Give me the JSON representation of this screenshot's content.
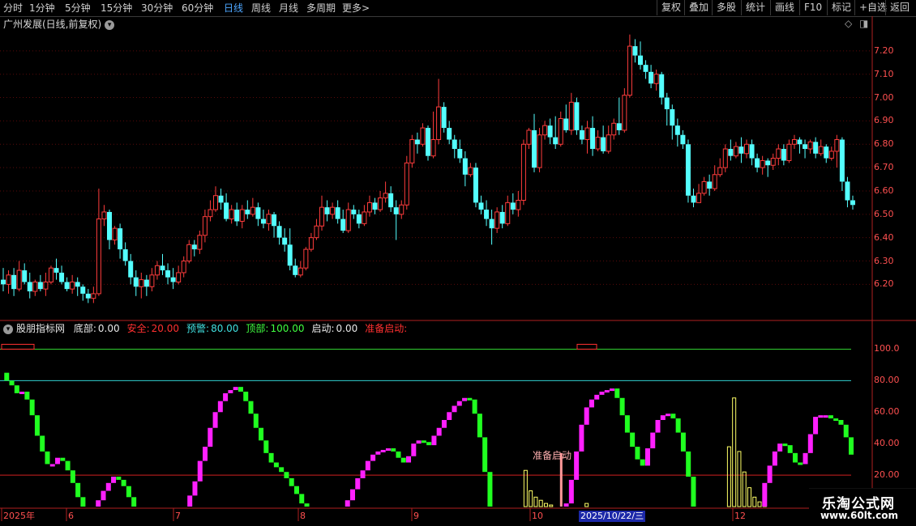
{
  "toolbar": {
    "periods": [
      "分时",
      "1分钟",
      "5分钟",
      "15分钟",
      "30分钟",
      "60分钟",
      "日线",
      "周线",
      "月线",
      "多周期",
      "更多"
    ],
    "more_arrow": ">",
    "right_buttons": [
      "复权",
      "叠加",
      "多股",
      "统计",
      "画线",
      "F10",
      "标记",
      "+自选",
      "返回"
    ]
  },
  "stock": {
    "title": "广州发展(日线,前复权)",
    "price_ticks": [
      "7.20",
      "7.10",
      "7.00",
      "6.90",
      "6.80",
      "6.70",
      "6.60",
      "6.50",
      "6.40",
      "6.30",
      "6.20"
    ]
  },
  "indicator": {
    "name": "股朋指标网",
    "items": [
      {
        "label": "底部:",
        "value": "0.00",
        "color": "#e8e8e8"
      },
      {
        "label": "安全:",
        "value": "20.00",
        "color": "#ff3030"
      },
      {
        "label": "预警:",
        "value": "80.00",
        "color": "#40e0e0"
      },
      {
        "label": "顶部:",
        "value": "100.00",
        "color": "#40ff40"
      },
      {
        "label": "启动:",
        "value": "0.00",
        "color": "#e8e8e8"
      },
      {
        "label": "准备启动:",
        "value": "",
        "color": "#ff3030"
      }
    ],
    "ticks": [
      "100.0",
      "80.00",
      "60.00",
      "40.00",
      "20.00"
    ],
    "annotation": "准备启动"
  },
  "x_axis": {
    "labels": [
      "2025年",
      "6",
      "7",
      "8",
      "9",
      "10",
      "2025/10/22/三",
      "12"
    ]
  },
  "watermark": {
    "line1": "乐淘公式网",
    "line2": "www.60lt.com"
  },
  "colors": {
    "up": "#ff3c3c",
    "down": "#54ffff",
    "magenta": "#ff20ff",
    "green": "#20ff20",
    "yellow": "#ffff66",
    "pink": "#ff9999"
  },
  "chart_data": {
    "type": "candlestick",
    "price_range": [
      6.08,
      7.3
    ],
    "candles": [
      [
        6.22,
        6.2,
        6.27,
        6.17
      ],
      [
        6.2,
        6.24,
        6.26,
        6.16
      ],
      [
        6.24,
        6.18,
        6.27,
        6.15
      ],
      [
        6.18,
        6.26,
        6.3,
        6.17
      ],
      [
        6.26,
        6.21,
        6.29,
        6.2
      ],
      [
        6.21,
        6.17,
        6.25,
        6.14
      ],
      [
        6.17,
        6.21,
        6.22,
        6.15
      ],
      [
        6.21,
        6.18,
        6.24,
        6.17
      ],
      [
        6.18,
        6.21,
        6.25,
        6.15
      ],
      [
        6.21,
        6.27,
        6.28,
        6.2
      ],
      [
        6.27,
        6.25,
        6.31,
        6.22
      ],
      [
        6.25,
        6.21,
        6.28,
        6.2
      ],
      [
        6.21,
        6.18,
        6.23,
        6.17
      ],
      [
        6.18,
        6.21,
        6.24,
        6.16
      ],
      [
        6.21,
        6.19,
        6.23,
        6.15
      ],
      [
        6.19,
        6.16,
        6.2,
        6.13
      ],
      [
        6.16,
        6.14,
        6.18,
        6.12
      ],
      [
        6.14,
        6.16,
        6.19,
        6.12
      ],
      [
        6.16,
        6.48,
        6.61,
        6.15
      ],
      [
        6.48,
        6.51,
        6.54,
        6.45
      ],
      [
        6.51,
        6.39,
        6.52,
        6.35
      ],
      [
        6.39,
        6.44,
        6.45,
        6.37
      ],
      [
        6.44,
        6.35,
        6.46,
        6.31
      ],
      [
        6.35,
        6.3,
        6.38,
        6.28
      ],
      [
        6.3,
        6.23,
        6.33,
        6.2
      ],
      [
        6.23,
        6.19,
        6.26,
        6.15
      ],
      [
        6.19,
        6.22,
        6.25,
        6.14
      ],
      [
        6.22,
        6.19,
        6.24,
        6.15
      ],
      [
        6.19,
        6.24,
        6.27,
        6.17
      ],
      [
        6.24,
        6.28,
        6.3,
        6.22
      ],
      [
        6.28,
        6.26,
        6.33,
        6.24
      ],
      [
        6.26,
        6.23,
        6.29,
        6.2
      ],
      [
        6.23,
        6.21,
        6.27,
        6.18
      ],
      [
        6.21,
        6.25,
        6.28,
        6.2
      ],
      [
        6.25,
        6.3,
        6.32,
        6.23
      ],
      [
        6.3,
        6.37,
        6.39,
        6.29
      ],
      [
        6.37,
        6.35,
        6.39,
        6.32
      ],
      [
        6.35,
        6.41,
        6.43,
        6.33
      ],
      [
        6.41,
        6.49,
        6.52,
        6.38
      ],
      [
        6.49,
        6.52,
        6.56,
        6.47
      ],
      [
        6.52,
        6.58,
        6.62,
        6.51
      ],
      [
        6.58,
        6.55,
        6.61,
        6.52
      ],
      [
        6.55,
        6.48,
        6.59,
        6.47
      ],
      [
        6.48,
        6.52,
        6.54,
        6.46
      ],
      [
        6.52,
        6.47,
        6.55,
        6.45
      ],
      [
        6.47,
        6.52,
        6.54,
        6.44
      ],
      [
        6.52,
        6.5,
        6.56,
        6.48
      ],
      [
        6.5,
        6.53,
        6.57,
        6.49
      ],
      [
        6.53,
        6.48,
        6.55,
        6.45
      ],
      [
        6.48,
        6.46,
        6.52,
        6.44
      ],
      [
        6.46,
        6.5,
        6.52,
        6.43
      ],
      [
        6.5,
        6.45,
        6.51,
        6.4
      ],
      [
        6.45,
        6.4,
        6.47,
        6.37
      ],
      [
        6.4,
        6.37,
        6.44,
        6.34
      ],
      [
        6.37,
        6.28,
        6.44,
        6.26
      ],
      [
        6.28,
        6.24,
        6.31,
        6.23
      ],
      [
        6.24,
        6.27,
        6.3,
        6.23
      ],
      [
        6.27,
        6.35,
        6.36,
        6.26
      ],
      [
        6.35,
        6.4,
        6.42,
        6.34
      ],
      [
        6.4,
        6.45,
        6.48,
        6.39
      ],
      [
        6.45,
        6.53,
        6.58,
        6.43
      ],
      [
        6.53,
        6.5,
        6.56,
        6.47
      ],
      [
        6.5,
        6.53,
        6.55,
        6.48
      ],
      [
        6.53,
        6.48,
        6.56,
        6.46
      ],
      [
        6.48,
        6.43,
        6.52,
        6.42
      ],
      [
        6.43,
        6.52,
        6.55,
        6.42
      ],
      [
        6.52,
        6.5,
        6.54,
        6.48
      ],
      [
        6.5,
        6.46,
        6.52,
        6.44
      ],
      [
        6.46,
        6.51,
        6.54,
        6.45
      ],
      [
        6.51,
        6.55,
        6.58,
        6.49
      ],
      [
        6.55,
        6.52,
        6.57,
        6.5
      ],
      [
        6.52,
        6.57,
        6.6,
        6.51
      ],
      [
        6.57,
        6.59,
        6.64,
        6.55
      ],
      [
        6.59,
        6.53,
        6.62,
        6.51
      ],
      [
        6.53,
        6.5,
        6.56,
        6.39
      ],
      [
        6.5,
        6.54,
        6.56,
        6.48
      ],
      [
        6.54,
        6.72,
        6.75,
        6.52
      ],
      [
        6.72,
        6.82,
        6.84,
        6.7
      ],
      [
        6.82,
        6.8,
        6.85,
        6.76
      ],
      [
        6.8,
        6.87,
        6.89,
        6.79
      ],
      [
        6.87,
        6.75,
        6.88,
        6.73
      ],
      [
        6.75,
        6.82,
        6.94,
        6.74
      ],
      [
        6.82,
        6.96,
        7.08,
        6.8
      ],
      [
        6.96,
        6.87,
        6.98,
        6.85
      ],
      [
        6.87,
        6.82,
        6.9,
        6.8
      ],
      [
        6.82,
        6.78,
        6.84,
        6.74
      ],
      [
        6.78,
        6.74,
        6.82,
        6.72
      ],
      [
        6.74,
        6.67,
        6.77,
        6.62
      ],
      [
        6.67,
        6.7,
        6.72,
        6.66
      ],
      [
        6.7,
        6.55,
        6.72,
        6.53
      ],
      [
        6.55,
        6.52,
        6.58,
        6.5
      ],
      [
        6.52,
        6.48,
        6.56,
        6.45
      ],
      [
        6.48,
        6.44,
        6.52,
        6.37
      ],
      [
        6.44,
        6.51,
        6.53,
        6.42
      ],
      [
        6.51,
        6.46,
        6.54,
        6.44
      ],
      [
        6.46,
        6.55,
        6.58,
        6.45
      ],
      [
        6.55,
        6.52,
        6.59,
        6.5
      ],
      [
        6.52,
        6.56,
        6.6,
        6.49
      ],
      [
        6.56,
        6.8,
        6.82,
        6.54
      ],
      [
        6.8,
        6.86,
        6.87,
        6.78
      ],
      [
        6.86,
        6.7,
        6.93,
        6.68
      ],
      [
        6.7,
        6.84,
        6.87,
        6.68
      ],
      [
        6.84,
        6.88,
        6.9,
        6.82
      ],
      [
        6.88,
        6.83,
        6.91,
        6.8
      ],
      [
        6.83,
        6.8,
        6.92,
        6.78
      ],
      [
        6.8,
        6.91,
        6.94,
        6.79
      ],
      [
        6.91,
        6.86,
        6.97,
        6.85
      ],
      [
        6.86,
        6.98,
        7.02,
        6.84
      ],
      [
        6.98,
        6.86,
        7.0,
        6.84
      ],
      [
        6.86,
        6.82,
        6.88,
        6.8
      ],
      [
        6.82,
        6.87,
        6.9,
        6.76
      ],
      [
        6.87,
        6.78,
        6.92,
        6.75
      ],
      [
        6.78,
        6.83,
        6.86,
        6.77
      ],
      [
        6.83,
        6.77,
        6.88,
        6.76
      ],
      [
        6.77,
        6.84,
        6.88,
        6.76
      ],
      [
        6.84,
        6.89,
        6.91,
        6.82
      ],
      [
        6.89,
        6.86,
        7.0,
        6.84
      ],
      [
        6.86,
        7.01,
        7.04,
        6.85
      ],
      [
        7.01,
        7.22,
        7.27,
        7.0
      ],
      [
        7.22,
        7.18,
        7.25,
        7.15
      ],
      [
        7.18,
        7.14,
        7.24,
        7.12
      ],
      [
        7.14,
        7.11,
        7.16,
        7.08
      ],
      [
        7.11,
        7.06,
        7.14,
        7.04
      ],
      [
        7.06,
        7.1,
        7.12,
        7.03
      ],
      [
        7.1,
        7.0,
        7.11,
        6.97
      ],
      [
        7.0,
        6.95,
        7.02,
        6.88
      ],
      [
        6.95,
        6.88,
        6.97,
        6.82
      ],
      [
        6.88,
        6.84,
        6.91,
        6.79
      ],
      [
        6.84,
        6.8,
        6.86,
        6.78
      ],
      [
        6.8,
        6.58,
        6.82,
        6.55
      ],
      [
        6.58,
        6.55,
        6.61,
        6.53
      ],
      [
        6.55,
        6.59,
        6.63,
        6.56
      ],
      [
        6.59,
        6.64,
        6.66,
        6.58
      ],
      [
        6.64,
        6.61,
        6.67,
        6.58
      ],
      [
        6.61,
        6.67,
        6.71,
        6.6
      ],
      [
        6.67,
        6.7,
        6.74,
        6.66
      ],
      [
        6.7,
        6.78,
        6.8,
        6.68
      ],
      [
        6.78,
        6.75,
        6.82,
        6.73
      ],
      [
        6.75,
        6.79,
        6.81,
        6.74
      ],
      [
        6.79,
        6.76,
        6.83,
        6.72
      ],
      [
        6.76,
        6.8,
        6.82,
        6.74
      ],
      [
        6.8,
        6.74,
        6.82,
        6.71
      ],
      [
        6.74,
        6.7,
        6.76,
        6.68
      ],
      [
        6.7,
        6.73,
        6.75,
        6.67
      ],
      [
        6.73,
        6.71,
        6.74,
        6.66
      ],
      [
        6.71,
        6.74,
        6.76,
        6.69
      ],
      [
        6.74,
        6.78,
        6.8,
        6.71
      ],
      [
        6.78,
        6.73,
        6.8,
        6.71
      ],
      [
        6.73,
        6.8,
        6.82,
        6.72
      ],
      [
        6.8,
        6.82,
        6.84,
        6.78
      ],
      [
        6.82,
        6.8,
        6.83,
        6.76
      ],
      [
        6.8,
        6.78,
        6.82,
        6.74
      ],
      [
        6.78,
        6.81,
        6.82,
        6.76
      ],
      [
        6.81,
        6.76,
        6.83,
        6.74
      ],
      [
        6.76,
        6.79,
        6.82,
        6.75
      ],
      [
        6.79,
        6.74,
        6.8,
        6.72
      ],
      [
        6.74,
        6.77,
        6.79,
        6.73
      ],
      [
        6.77,
        6.82,
        6.84,
        6.7
      ],
      [
        6.82,
        6.64,
        6.83,
        6.6
      ],
      [
        6.64,
        6.56,
        6.66,
        6.53
      ],
      [
        6.56,
        6.54,
        6.58,
        6.52
      ]
    ],
    "indicator_series": {
      "range": [
        0,
        110
      ],
      "values": [
        85,
        80,
        77,
        72,
        73,
        68,
        58,
        45,
        35,
        27,
        27,
        31,
        29,
        23,
        15,
        6,
        0,
        0,
        0,
        4,
        10,
        15,
        19,
        17,
        13,
        6,
        0,
        0,
        0,
        0,
        0,
        0,
        0,
        0,
        0,
        0,
        0,
        7,
        16,
        29,
        38,
        50,
        60,
        67,
        72,
        74,
        76,
        73,
        67,
        59,
        50,
        42,
        34,
        28,
        25,
        22,
        18,
        13,
        8,
        2,
        0,
        0,
        0,
        0,
        0,
        0,
        0,
        0,
        4,
        11,
        18,
        23,
        29,
        33,
        35,
        36,
        37,
        35,
        31,
        28,
        32,
        40,
        42,
        41,
        39,
        45,
        50,
        55,
        60,
        64,
        67,
        69,
        68,
        59,
        44,
        22,
        0,
        0,
        0,
        0,
        0,
        0,
        0,
        0,
        0,
        0,
        0,
        0,
        0,
        0,
        0,
        2,
        17,
        35,
        52,
        63,
        68,
        71,
        73,
        74,
        75,
        69,
        58,
        47,
        38,
        30,
        26,
        37,
        47,
        55,
        58,
        59,
        56,
        47,
        35,
        19,
        0,
        0,
        0,
        0,
        0,
        0,
        0,
        0,
        0,
        0,
        0,
        0,
        0,
        0,
        15,
        26,
        35,
        40,
        39,
        34,
        28,
        27,
        34,
        46,
        57,
        58,
        58,
        56,
        55,
        52,
        44,
        33
      ]
    },
    "yellow_bars": [
      [
        103,
        23
      ],
      [
        104,
        10
      ],
      [
        105,
        6
      ],
      [
        106,
        4
      ],
      [
        107,
        2
      ],
      [
        108,
        1
      ],
      [
        115,
        2
      ],
      [
        142,
        0
      ],
      [
        143,
        38
      ],
      [
        144,
        69
      ],
      [
        145,
        35
      ],
      [
        146,
        22
      ],
      [
        147,
        12
      ],
      [
        148,
        6
      ],
      [
        149,
        3
      ],
      [
        150,
        2
      ]
    ],
    "pink_bars": [
      [
        110,
        34
      ]
    ]
  }
}
